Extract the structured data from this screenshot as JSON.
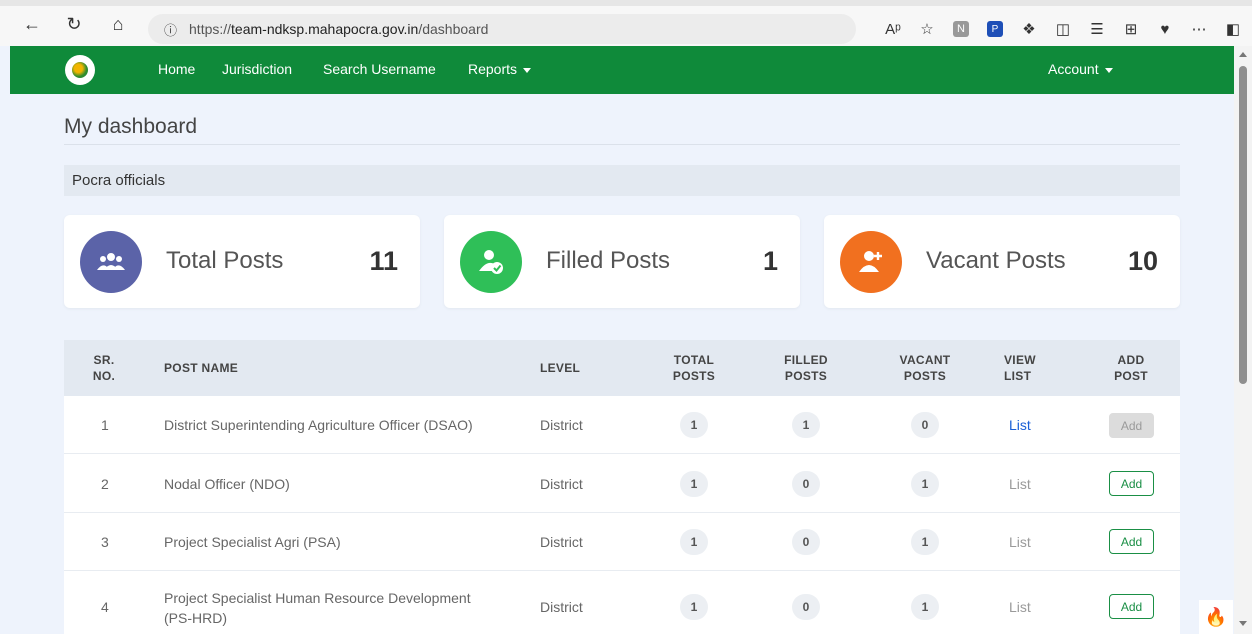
{
  "browser": {
    "url_prefix": "https://",
    "url_host": "team-ndksp.mahapocra.gov.in",
    "url_path": "/dashboard",
    "ext_badge": "N",
    "ext_blue": "P"
  },
  "nav": {
    "home": "Home",
    "jurisdiction": "Jurisdiction",
    "search_username": "Search Username",
    "reports": "Reports",
    "account": "Account"
  },
  "page": {
    "title": "My dashboard",
    "section": "Pocra officials"
  },
  "stats": [
    {
      "label": "Total Posts",
      "value": "11",
      "color": "#5b63a8",
      "icon": "users-icon"
    },
    {
      "label": "Filled Posts",
      "value": "1",
      "color": "#2fbf58",
      "icon": "user-check-icon"
    },
    {
      "label": "Vacant Posts",
      "value": "10",
      "color": "#f1701f",
      "icon": "user-plus-icon"
    }
  ],
  "table": {
    "headers": {
      "sr_no": [
        "SR.",
        "NO."
      ],
      "post_name": "POST NAME",
      "level": "LEVEL",
      "total_posts": [
        "TOTAL",
        "POSTS"
      ],
      "filled_posts": [
        "FILLED",
        "POSTS"
      ],
      "vacant_posts": [
        "VACANT",
        "POSTS"
      ],
      "view_list": [
        "VIEW",
        "LIST"
      ],
      "add_post": [
        "ADD",
        "POST"
      ]
    },
    "rows": [
      {
        "sr": "1",
        "post_name": "District Superintending Agriculture Officer (DSAO)",
        "level": "District",
        "total": "1",
        "filled": "1",
        "vacant": "0",
        "list": "List",
        "list_active": true,
        "add": "Add",
        "add_enabled": false
      },
      {
        "sr": "2",
        "post_name": "Nodal Officer (NDO)",
        "level": "District",
        "total": "1",
        "filled": "0",
        "vacant": "1",
        "list": "List",
        "list_active": false,
        "add": "Add",
        "add_enabled": true
      },
      {
        "sr": "3",
        "post_name": "Project Specialist Agri (PSA)",
        "level": "District",
        "total": "1",
        "filled": "0",
        "vacant": "1",
        "list": "List",
        "list_active": false,
        "add": "Add",
        "add_enabled": true
      },
      {
        "sr": "4",
        "post_name_line1": "Project Specialist Human Resource Development",
        "post_name_line2": "(PS-HRD)",
        "level": "District",
        "total": "1",
        "filled": "0",
        "vacant": "1",
        "list": "List",
        "list_active": false,
        "add": "Add",
        "add_enabled": true
      }
    ]
  },
  "colors": {
    "nav_green": "#0f8a3a",
    "link_blue": "#1a5fd6",
    "link_muted": "#9a9a9a",
    "add_green": "#1a8f45"
  }
}
